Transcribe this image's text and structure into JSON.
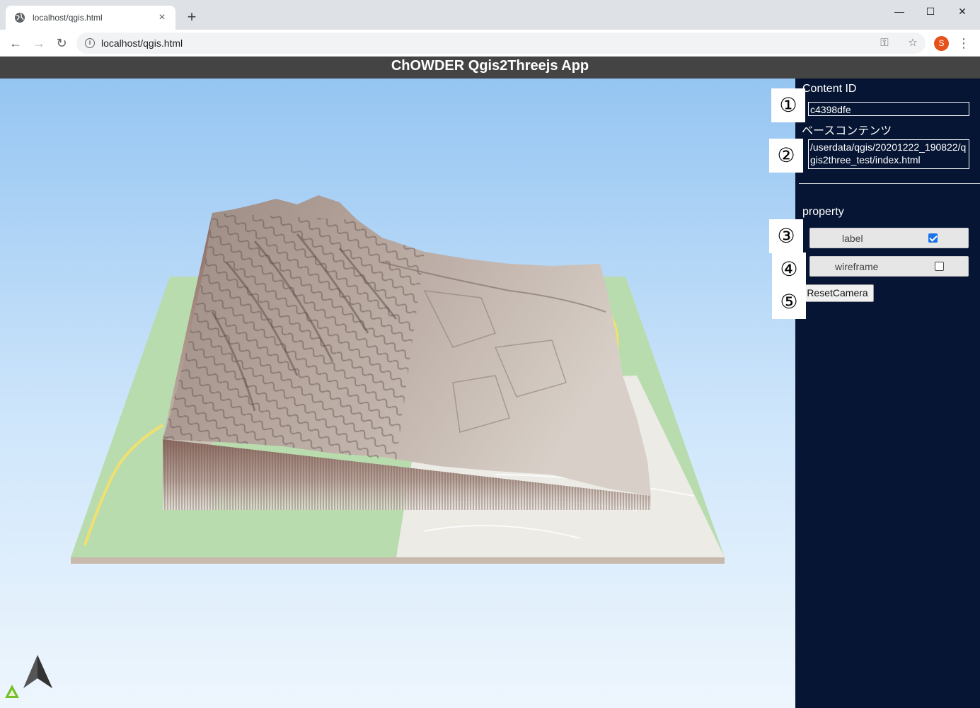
{
  "browser": {
    "tab_title": "localhost/qgis.html",
    "url": "localhost/qgis.html",
    "profile_initial": "S",
    "accent_color": "#e8501b"
  },
  "app": {
    "title": "ChOWDER Qgis2Threejs App"
  },
  "panel": {
    "content_id_label": "Content ID",
    "content_id_value": "c4398dfe",
    "base_content_label": "ベースコンテンツ",
    "base_content_value": "/userdata/qgis/20201222_190822/qgis2three_test/index.html",
    "property_label": "property",
    "properties": [
      {
        "label": "label",
        "checked": true
      },
      {
        "label": "wireframe",
        "checked": false
      }
    ],
    "reset_camera_label": "ResetCamera",
    "background_color": "#061533"
  },
  "markers": [
    "①",
    "②",
    "③",
    "④",
    "⑤"
  ]
}
